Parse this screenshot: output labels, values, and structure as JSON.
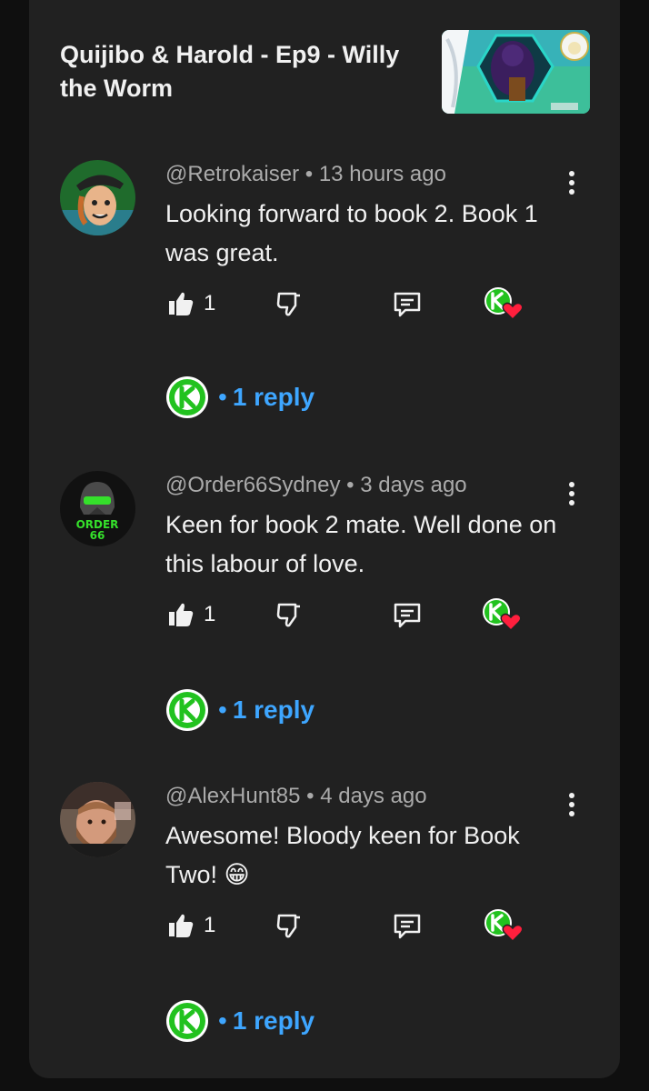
{
  "video": {
    "title": "Quijibo & Harold - Ep9 - Willy the Worm"
  },
  "comments": [
    {
      "handle": "@Retrokaiser",
      "time": "13 hours ago",
      "text": "Looking forward to book 2. Book 1 was great.",
      "likes": "1",
      "replies": "1 reply",
      "avatar_icon": "cartoon-man-hat-avatar"
    },
    {
      "handle": "@Order66Sydney",
      "time": "3 days ago",
      "text": "Keen for book 2 mate. Well done on this labour of love.",
      "likes": "1",
      "replies": "1 reply",
      "avatar_icon": "order66-helmet-avatar",
      "avatar_text_1": "ORDER",
      "avatar_text_2": "66"
    },
    {
      "handle": "@AlexHunt85",
      "time": "4 days ago",
      "text": "Awesome! Bloody keen for Book Two! 😁",
      "likes": "1",
      "replies": "1 reply",
      "avatar_icon": "bearded-man-photo-avatar"
    }
  ],
  "separator": "•",
  "colors": {
    "background": "#0f0f0f",
    "card": "#212121",
    "link": "#3ea6ff",
    "badge_green": "#22c21f",
    "heart": "#ff1f3d",
    "muted_text": "#aaaaaa"
  }
}
